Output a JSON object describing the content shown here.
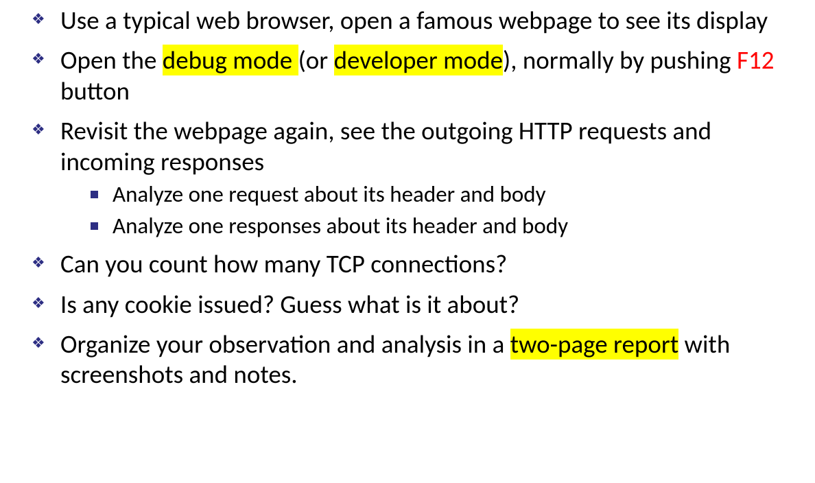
{
  "bullets": [
    {
      "segments": [
        {
          "text": "Use a typical web browser, open a famous webpage to see its display"
        }
      ]
    },
    {
      "segments": [
        {
          "text": "Open the "
        },
        {
          "text": "debug mode ",
          "highlight": true
        },
        {
          "text": "(or "
        },
        {
          "text": "developer mode",
          "highlight": true
        },
        {
          "text": "), normally by pushing "
        },
        {
          "text": "F12",
          "red": true
        },
        {
          "text": " button"
        }
      ]
    },
    {
      "segments": [
        {
          "text": "Revisit the webpage again, see the outgoing HTTP requests and incoming responses"
        }
      ],
      "sub": [
        {
          "segments": [
            {
              "text": "Analyze one request about its header and body"
            }
          ]
        },
        {
          "segments": [
            {
              "text": "Analyze one responses about its header and body"
            }
          ]
        }
      ]
    },
    {
      "segments": [
        {
          "text": "Can you count how many TCP connections?"
        }
      ]
    },
    {
      "segments": [
        {
          "text": "Is any cookie issued? Guess what is it about?"
        }
      ]
    },
    {
      "segments": [
        {
          "text": "Organize your observation and analysis in a "
        },
        {
          "text": "two-page report",
          "highlight": true
        },
        {
          "text": " with screenshots and notes."
        }
      ]
    }
  ]
}
